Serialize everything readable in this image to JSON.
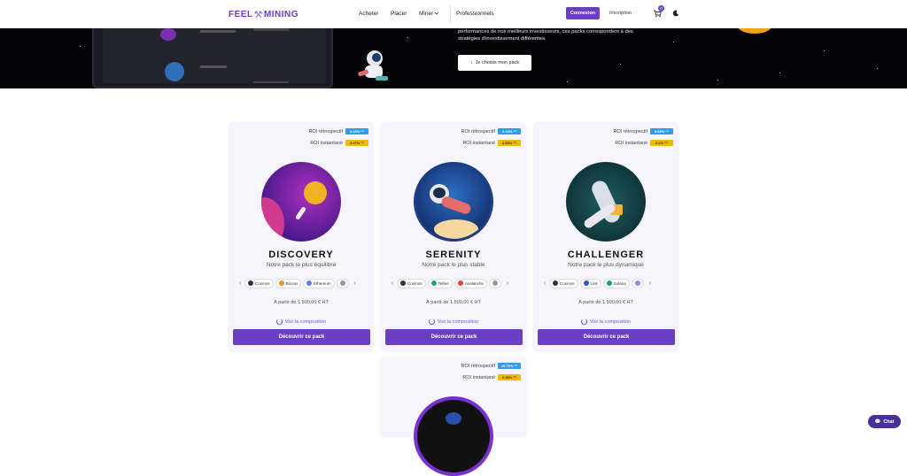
{
  "nav": {
    "logo_left": "FEEL",
    "logo_right": "MINING",
    "links": [
      "Acheter",
      "Placer",
      "Miner"
    ],
    "pro": "Professionnels",
    "login": "Connexion",
    "signup": "Inscription",
    "cart_count": "0",
    "brand_color": "#6b3fc2"
  },
  "hero": {
    "text": "performances de nos meilleurs investisseurs, ces packs correspondent à des stratégies d'investissement différentes.",
    "cta": "Je choisis mon pack"
  },
  "cards": [
    {
      "roi_retro_label": "ROI rétrospectif",
      "roi_retro": "0.45% ⁽¹⁾",
      "roi_inst_label": "ROI instantané",
      "roi_inst": "3.47% ⁽²⁾",
      "title": "DISCOVERY",
      "subtitle": "Notre pack le plus équilibré",
      "coins": [
        "Cosmos",
        "Bitcoin",
        "Ethereum"
      ],
      "price": "À partir de 1.500,00 € HT",
      "compo": "Voir la composition",
      "button": "Découvrir ce pack"
    },
    {
      "roi_retro_label": "ROI rétrospectif",
      "roi_retro": "0.24% ⁽¹⁾",
      "roi_inst_label": "ROI instantané",
      "roi_inst": "4.58% ⁽²⁾",
      "title": "SERENITY",
      "subtitle": "Notre pack le plus stable",
      "coins": [
        "Cosmos",
        "Tether",
        "Avalanche"
      ],
      "price": "À partir de 1.500,00 € HT",
      "compo": "Voir la composition",
      "button": "Découvrir ce pack"
    },
    {
      "roi_retro_label": "ROI rétrospectif",
      "roi_retro": "9.89% ⁽¹⁾",
      "roi_inst_label": "ROI instantané",
      "roi_inst": "5.2% ⁽²⁾",
      "title": "CHALLENGER",
      "subtitle": "Notre pack le plus dynamique",
      "coins": [
        "Cosmos",
        "Link",
        "Solana"
      ],
      "price": "À partir de 1.500,00 € HT",
      "compo": "Voir la composition",
      "button": "Découvrir ce pack"
    },
    {
      "roi_retro_label": "ROI rétrospectif",
      "roi_retro": "10.76% ⁽¹⁾",
      "roi_inst_label": "ROI instantané",
      "roi_inst": "6.36% ⁽²⁾"
    }
  ],
  "chat": "Chat"
}
